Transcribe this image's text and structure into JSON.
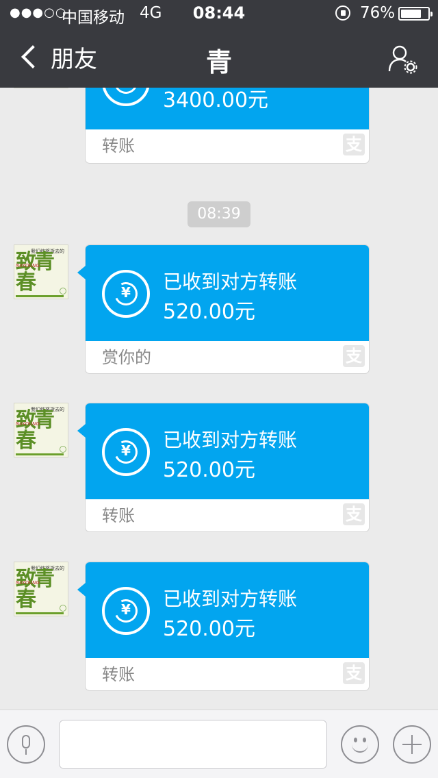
{
  "status_bar": {
    "signal_dots": "●●●○○",
    "carrier": "中国移动",
    "network": "4G",
    "time": "08:44",
    "battery_pct": "76%",
    "battery_level": 0.76
  },
  "nav": {
    "back_label": "朋友",
    "title": "青",
    "profile_icon": "person-gear-icon"
  },
  "avatar": {
    "big_text": "致青春",
    "tiny_text": "我们终将逝去的",
    "young_text": "NoYOUNG"
  },
  "messages": [
    {
      "title": "",
      "amount": "3400.00元",
      "note": "转账"
    },
    {
      "title": "已收到对方转账",
      "amount": "520.00元",
      "note": "赏你的"
    },
    {
      "title": "已收到对方转账",
      "amount": "520.00元",
      "note": "转账"
    },
    {
      "title": "已收到对方转账",
      "amount": "520.00元",
      "note": "转账"
    }
  ],
  "time_divider": "08:39",
  "transfer_icon": {
    "name": "yen-transfer-icon",
    "glyph": "¥"
  },
  "pay_icon": {
    "name": "alipay-icon",
    "glyph": "支"
  },
  "colors": {
    "header_bg": "#393a3f",
    "card_blue": "#02a5ef",
    "chat_bg": "#ebebeb"
  },
  "input_bar": {
    "voice_icon": "microphone-icon",
    "emoji_icon": "smiley-icon",
    "plus_icon": "plus-icon",
    "input_value": ""
  }
}
